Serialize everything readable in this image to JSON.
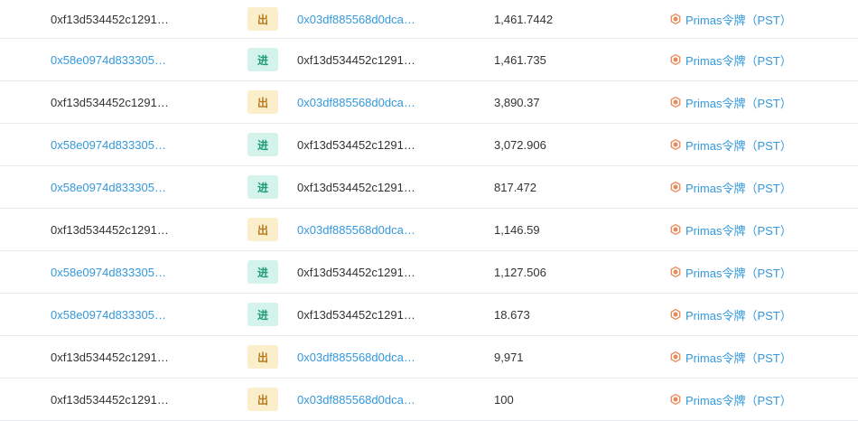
{
  "colors": {
    "link": "#3498db",
    "text": "#333333",
    "badge_out_bg": "#fbeecb",
    "badge_out_fg": "#b7791f",
    "badge_in_bg": "#d4f3ea",
    "badge_in_fg": "#1d9d74",
    "token_icon": "#e8895a"
  },
  "token_icon_name": "primas-hex-icon",
  "rows": [
    {
      "from": "0xf13d534452c1291…",
      "from_link": false,
      "dir": "出",
      "dir_type": "out",
      "to": "0x03df885568d0dca…",
      "to_link": true,
      "qty": "1,461.7442",
      "token": "Primas令牌（PST）"
    },
    {
      "from": "0x58e0974d833305…",
      "from_link": true,
      "dir": "进",
      "dir_type": "in",
      "to": "0xf13d534452c1291…",
      "to_link": false,
      "qty": "1,461.735",
      "token": "Primas令牌（PST）"
    },
    {
      "from": "0xf13d534452c1291…",
      "from_link": false,
      "dir": "出",
      "dir_type": "out",
      "to": "0x03df885568d0dca…",
      "to_link": true,
      "qty": "3,890.37",
      "token": "Primas令牌（PST）"
    },
    {
      "from": "0x58e0974d833305…",
      "from_link": true,
      "dir": "进",
      "dir_type": "in",
      "to": "0xf13d534452c1291…",
      "to_link": false,
      "qty": "3,072.906",
      "token": "Primas令牌（PST）"
    },
    {
      "from": "0x58e0974d833305…",
      "from_link": true,
      "dir": "进",
      "dir_type": "in",
      "to": "0xf13d534452c1291…",
      "to_link": false,
      "qty": "817.472",
      "token": "Primas令牌（PST）"
    },
    {
      "from": "0xf13d534452c1291…",
      "from_link": false,
      "dir": "出",
      "dir_type": "out",
      "to": "0x03df885568d0dca…",
      "to_link": true,
      "qty": "1,146.59",
      "token": "Primas令牌（PST）"
    },
    {
      "from": "0x58e0974d833305…",
      "from_link": true,
      "dir": "进",
      "dir_type": "in",
      "to": "0xf13d534452c1291…",
      "to_link": false,
      "qty": "1,127.506",
      "token": "Primas令牌（PST）"
    },
    {
      "from": "0x58e0974d833305…",
      "from_link": true,
      "dir": "进",
      "dir_type": "in",
      "to": "0xf13d534452c1291…",
      "to_link": false,
      "qty": "18.673",
      "token": "Primas令牌（PST）"
    },
    {
      "from": "0xf13d534452c1291…",
      "from_link": false,
      "dir": "出",
      "dir_type": "out",
      "to": "0x03df885568d0dca…",
      "to_link": true,
      "qty": "9,971",
      "token": "Primas令牌（PST）"
    },
    {
      "from": "0xf13d534452c1291…",
      "from_link": false,
      "dir": "出",
      "dir_type": "out",
      "to": "0x03df885568d0dca…",
      "to_link": true,
      "qty": "100",
      "token": "Primas令牌（PST）"
    }
  ]
}
